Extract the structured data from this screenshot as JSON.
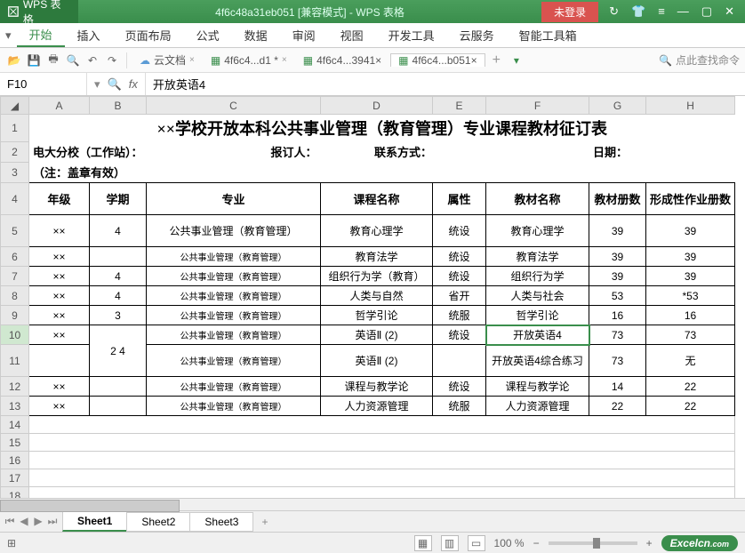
{
  "app": {
    "name": "WPS 表格",
    "doc_title": "4f6c48a31eb051 [兼容模式] - WPS 表格",
    "login": "未登录"
  },
  "menu": {
    "start": "开始",
    "insert": "插入",
    "page_layout": "页面布局",
    "formula": "公式",
    "data": "数据",
    "review": "审阅",
    "view": "视图",
    "dev": "开发工具",
    "cloud": "云服务",
    "smart": "智能工具箱"
  },
  "tabs": {
    "cloud_doc": "云文档",
    "t1": "4f6c4...d1 *",
    "t2": "4f6c4...3941×",
    "t3": "4f6c4...b051×"
  },
  "toolbar": {
    "search_placeholder": "点此查找命令"
  },
  "formula": {
    "cell_name": "F10",
    "fx": "fx",
    "value": "开放英语4"
  },
  "columns": [
    "A",
    "B",
    "C",
    "D",
    "E",
    "F",
    "G",
    "H"
  ],
  "title": "××学校开放本科公共事业管理（教育管理）专业课程教材征订表",
  "info": {
    "line2_a": "电大分校（工作站）：",
    "line2_b": "报订人：",
    "line2_c": "联系方式：",
    "line2_d": "日期：",
    "line3": "（注：盖章有效）"
  },
  "headers": {
    "grade": "年级",
    "semester": "学期",
    "major": "专业",
    "course": "课程名称",
    "attr": "属性",
    "book": "教材名称",
    "copies": "教材册数",
    "form": "形成性作业册数"
  },
  "rows": [
    {
      "a": "××",
      "b": "4",
      "c": "公共事业管理（教育管理）",
      "d": "教育心理学",
      "e": "统设",
      "f": "教育心理学",
      "g": "39",
      "h": "39"
    },
    {
      "a": "××",
      "b": "",
      "c": "公共事业管理（教育管理）",
      "d": "教育法学",
      "e": "统设",
      "f": "教育法学",
      "g": "39",
      "h": "39"
    },
    {
      "a": "××",
      "b": "4",
      "c": "公共事业管理（教育管理）",
      "d": "组织行为学（教育）",
      "e": "统设",
      "f": "组织行为学",
      "g": "39",
      "h": "39"
    },
    {
      "a": "××",
      "b": "4",
      "c": "公共事业管理（教育管理）",
      "d": "人类与自然",
      "e": "省开",
      "f": "人类与社会",
      "g": "53",
      "h": "*53"
    },
    {
      "a": "××",
      "b": "3",
      "c": "公共事业管理（教育管理）",
      "d": "哲学引论",
      "e": "统服",
      "f": "哲学引论",
      "g": "16",
      "h": "16"
    },
    {
      "a": "××",
      "b": "",
      "c": "公共事业管理（教育管理）",
      "d": "英语Ⅱ (2)",
      "e": "统设",
      "f": "开放英语4",
      "g": "73",
      "h": "73"
    },
    {
      "a": "",
      "b": "2    4",
      "c": "公共事业管理（教育管理）",
      "d": "英语Ⅱ (2)",
      "e": "",
      "f": "开放英语4综合练习",
      "g": "73",
      "h": "无"
    },
    {
      "a": "××",
      "b": "",
      "c": "公共事业管理（教育管理）",
      "d": "课程与教学论",
      "e": "统设",
      "f": "课程与教学论",
      "g": "14",
      "h": "22"
    },
    {
      "a": "××",
      "b": "",
      "c": "公共事业管理（教育管理）",
      "d": "人力资源管理",
      "e": "统服",
      "f": "人力资源管理",
      "g": "22",
      "h": "22"
    }
  ],
  "sheets": {
    "s1": "Sheet1",
    "s2": "Sheet2",
    "s3": "Sheet3"
  },
  "status": {
    "zoom": "100 %",
    "brand": "Excelcn",
    "brand_suffix": ".com"
  }
}
